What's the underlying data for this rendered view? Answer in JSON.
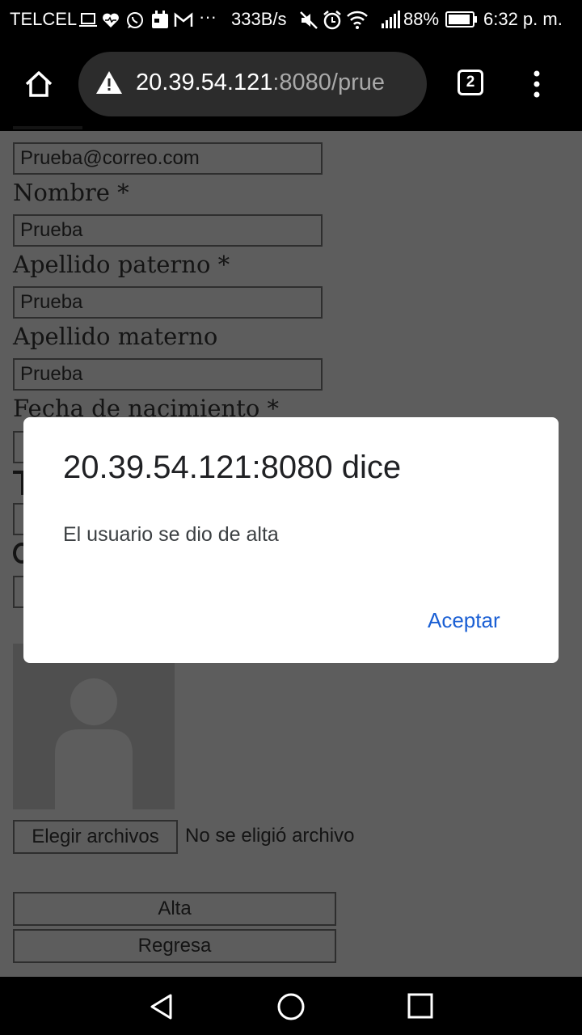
{
  "status_bar": {
    "carrier": "TELCEL",
    "speed": "333B/s",
    "battery": "88%",
    "time": "6:32 p. m."
  },
  "browser": {
    "url_host": "20.39.54.121",
    "url_path": ":8080/prue",
    "tab_count": "2"
  },
  "form": {
    "email_value": "Prueba@correo.com",
    "nombre_label": "Nombre *",
    "nombre_value": "Prueba",
    "apellido_paterno_label": "Apellido paterno *",
    "apellido_paterno_value": "Prueba",
    "apellido_materno_label": "Apellido materno",
    "apellido_materno_value": "Prueba",
    "fecha_label": "Fecha de nacimiento *",
    "choose_file_label": "Elegir archivos",
    "no_file_text": "No se eligió archivo",
    "alta_label": "Alta",
    "regresa_label": "Regresa"
  },
  "dialog": {
    "title": "20.39.54.121:8080 dice",
    "message": "El usuario se dio de alta",
    "ok_label": "Aceptar"
  },
  "colors": {
    "page_dimmed": "#5d5d5d",
    "dialog_link": "#1a5fd4"
  }
}
